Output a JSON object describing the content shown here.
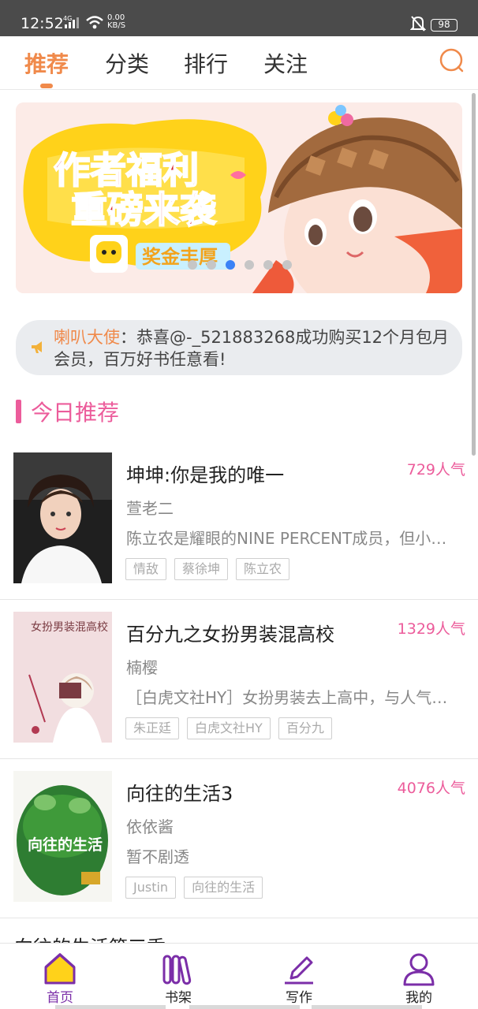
{
  "status": {
    "time": "12:52",
    "net_label": "4G",
    "speed_value": "0.00",
    "speed_unit": "KB/S",
    "battery": "98"
  },
  "top_tabs": [
    {
      "label": "推荐",
      "active": true
    },
    {
      "label": "分类",
      "active": false
    },
    {
      "label": "排行",
      "active": false
    },
    {
      "label": "关注",
      "active": false
    }
  ],
  "banner": {
    "headline_line1": "作者福利",
    "headline_line2": "重磅来袭",
    "badge": "奖金丰厚",
    "slide_count": 6,
    "active_slide": 3
  },
  "notice": {
    "name": "喇叭大使",
    "message": "：恭喜@-_521883268成功购买12个月包月会员，百万好书任意看!"
  },
  "section": {
    "title": "今日推荐"
  },
  "books": [
    {
      "title": "坤坤:你是我的唯一",
      "popularity": "729人气",
      "author": "萱老二",
      "description": "陈立农是耀眼的NINE PERCENT成员，但小陈立农也有自己的烦恼……",
      "tags": [
        "情敌",
        "蔡徐坤",
        "陈立农"
      ]
    },
    {
      "title": "百分九之女扮男装混高校",
      "popularity": "1329人气",
      "author": "楠樱",
      "description": "［白虎文社HY］女扮男装去上高中，与人气偶像同班……",
      "tags": [
        "朱正廷",
        "白虎文社HY",
        "百分九"
      ],
      "cover_text": "女扮男装混高校"
    },
    {
      "title": "向往的生活3",
      "popularity": "4076人气",
      "author": "依依酱",
      "description": "暂不剧透",
      "tags": [
        "Justin",
        "向往的生活"
      ],
      "cover_text": "向往的生活"
    }
  ],
  "peek_title": "向往的生活第三季",
  "bottom_nav": [
    {
      "label": "首页",
      "active": true
    },
    {
      "label": "书架",
      "active": false
    },
    {
      "label": "写作",
      "active": false
    },
    {
      "label": "我的",
      "active": false
    }
  ],
  "colors": {
    "accent_orange": "#f08a4b",
    "accent_pink": "#ec5c9b",
    "accent_purple": "#7b2ea8",
    "status_bar": "#4b4b4b"
  }
}
